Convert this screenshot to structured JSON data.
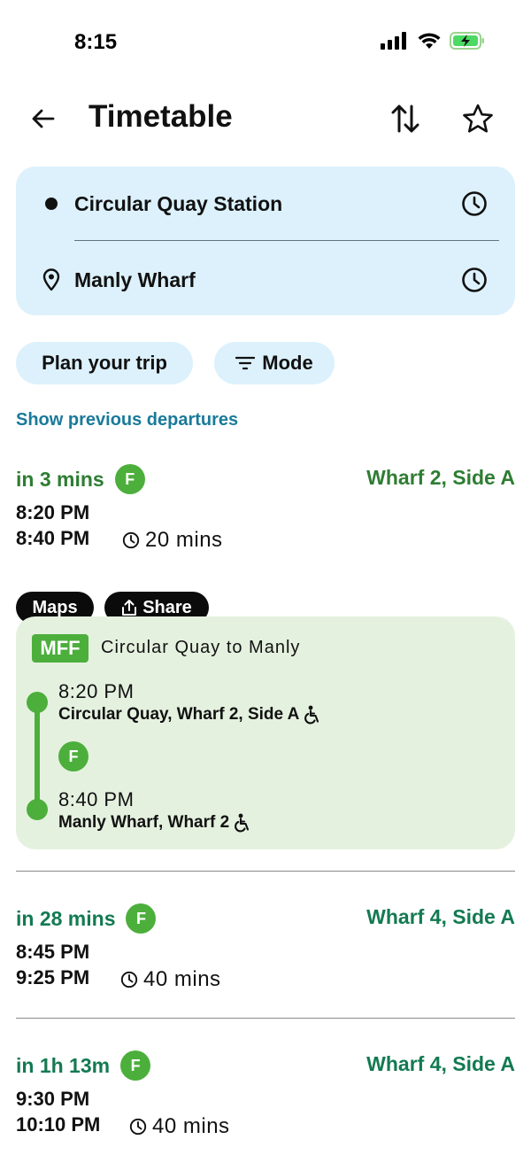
{
  "status": {
    "time": "8:15"
  },
  "header": {
    "title": "Timetable"
  },
  "trip": {
    "from": "Circular Quay Station",
    "to": "Manly Wharf"
  },
  "filters": {
    "plan_label": "Plan your trip",
    "mode_label": "Mode"
  },
  "previous_link": "Show previous departures",
  "departures": [
    {
      "in_time": "in 3 mins",
      "mode_badge": "F",
      "wharf": "Wharf 2, Side A",
      "depart": "8:20 PM",
      "arrive": "8:40 PM",
      "duration": "20 mins",
      "actions": {
        "maps": "Maps",
        "share": "Share"
      },
      "detail": {
        "route_badge": "MFF",
        "route_name": "Circular Quay to Manly",
        "stops": [
          {
            "time": "8:20 PM",
            "name": "Circular Quay, Wharf 2, Side A"
          },
          {
            "time": "8:40 PM",
            "name": "Manly Wharf, Wharf 2"
          }
        ],
        "mode_badge": "F"
      }
    },
    {
      "in_time": "in 28 mins",
      "mode_badge": "F",
      "wharf": "Wharf 4, Side A",
      "depart": "8:45 PM",
      "arrive": "9:25 PM",
      "duration": "40 mins"
    },
    {
      "in_time": "in 1h 13m",
      "mode_badge": "F",
      "wharf": "Wharf 4, Side A",
      "depart": "9:30 PM",
      "arrive": "10:10 PM",
      "duration": "40 mins"
    }
  ],
  "colors": {
    "accent_green": "#4caf3c",
    "card_blue": "#dcf1fb",
    "card_green": "#e5f1df",
    "link_blue": "#1a7a9a"
  }
}
